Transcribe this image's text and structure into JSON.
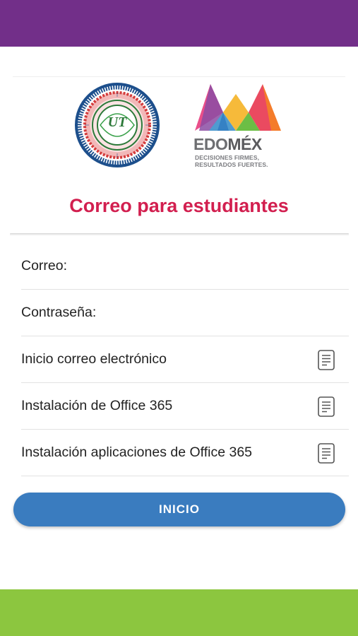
{
  "header": {
    "color": "#722f89"
  },
  "footer": {
    "color": "#8cc63f"
  },
  "logos": {
    "ut_seal": {
      "center_text": "UT"
    },
    "edomex": {
      "wordmark_left": "EDO",
      "wordmark_right": "MÉX",
      "slogan_line1": "DECISIONES FIRMES,",
      "slogan_line2": "RESULTADOS FUERTES."
    }
  },
  "title": "Correo para estudiantes",
  "form": {
    "email_label": "Correo:",
    "email_value": "",
    "password_label": "Contraseña:",
    "password_value": ""
  },
  "links": [
    {
      "label": "Inicio correo electrónico",
      "icon": "document-icon"
    },
    {
      "label": "Instalación de Office 365",
      "icon": "document-icon"
    },
    {
      "label": "Instalación aplicaciones de Office 365",
      "icon": "document-icon"
    }
  ],
  "button": {
    "label": "INICIO",
    "color": "#3a7cbf"
  },
  "colors": {
    "title": "#d21f4f"
  }
}
